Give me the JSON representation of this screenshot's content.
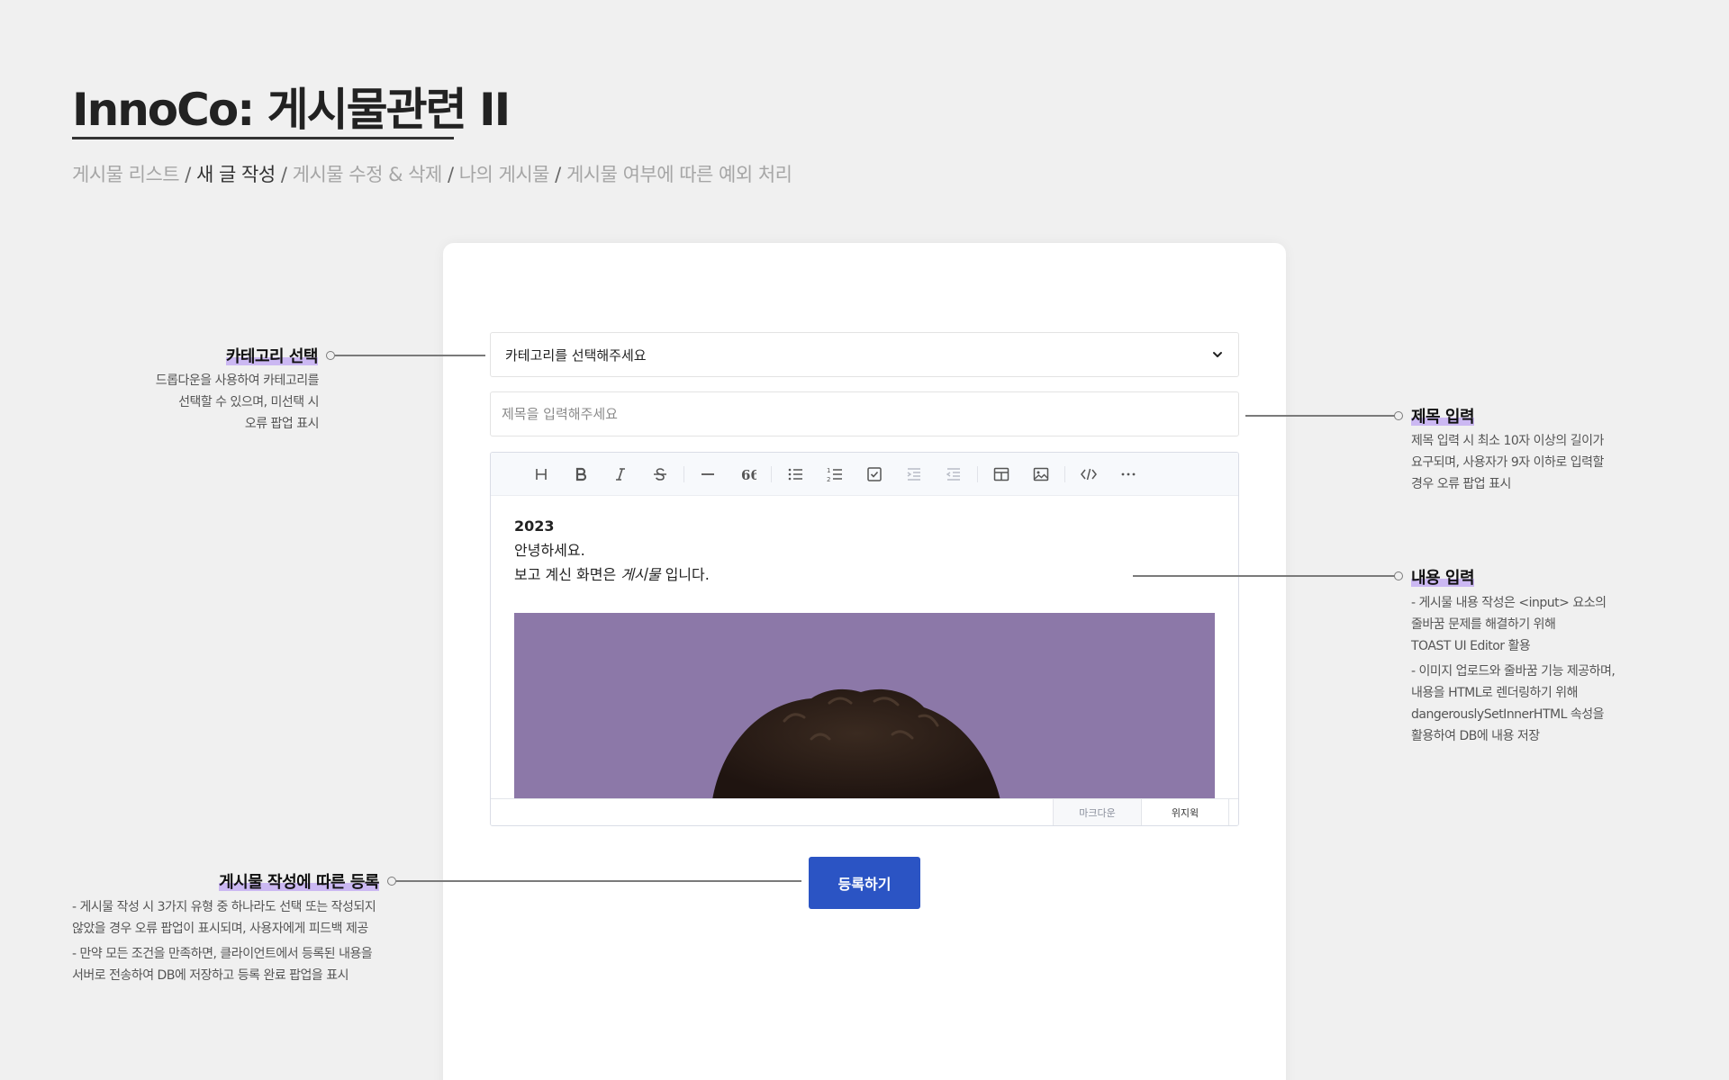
{
  "header": {
    "title": "InnoCo: 게시물관련 II",
    "breadcrumb": {
      "item1": "게시물 리스트",
      "active": "새 글 작성",
      "item3": "게시물 수정 & 삭제",
      "item4": "나의 게시물",
      "item5": "게시물 여부에 따른 예외 처리",
      "separator": " / "
    }
  },
  "form": {
    "category_placeholder": "카테고리를 선택해주세요",
    "title_placeholder": "제목을 입력해주세요",
    "editor": {
      "toolbar": [
        "heading-icon",
        "bold-icon",
        "italic-icon",
        "strike-icon",
        "hr-icon",
        "quote-icon",
        "bullet-list-icon",
        "ordered-list-icon",
        "task-list-icon",
        "indent-icon",
        "outdent-icon",
        "table-icon",
        "image-icon",
        "code-icon",
        "more-icon"
      ],
      "content": {
        "line1": "2023",
        "line2": "안녕하세요.",
        "line3_prefix": "보고 계신 화면은 ",
        "line3_italic": "게시물",
        "line3_suffix": " 입니다."
      },
      "mode_markdown": "마크다운",
      "mode_wysiwyg": "위지윅"
    },
    "submit_label": "등록하기",
    "accent_color": "#2b54c4",
    "image_bg_color": "#8c78a8"
  },
  "annotations": {
    "category": {
      "title": "카테고리 선택",
      "lines": [
        "드롭다운을 사용하여 카테고리를",
        "선택할 수 있으며, 미선택 시",
        "오류 팝업 표시"
      ]
    },
    "title": {
      "title": "제목 입력",
      "lines": [
        "제목 입력 시 최소 10자 이상의 길이가",
        "요구되며, 사용자가 9자 이하로 입력할",
        "경우 오류 팝업 표시"
      ]
    },
    "content": {
      "title": "내용 입력",
      "item1": [
        "- 게시물 내용 작성은 <input> 요소의",
        "줄바꿈 문제를 해결하기 위해",
        "TOAST UI Editor 활용"
      ],
      "item2": [
        "- 이미지 업로드와 줄바꿈 기능 제공하며,",
        "내용을 HTML로 렌더링하기 위해",
        "dangerouslySetInnerHTML 속성을",
        "활용하여 DB에 내용 저장"
      ]
    },
    "submit": {
      "title": "게시물 작성에 따른 등록",
      "item1": [
        "- 게시물 작성 시 3가지 유형 중 하나라도 선택 또는 작성되지",
        "않았을 경우 오류 팝업이 표시되며, 사용자에게 피드백 제공"
      ],
      "item2": [
        "- 만약 모든 조건을 만족하면, 클라이언트에서 등록된 내용을",
        "서버로 전송하여 DB에 저장하고 등록 완료 팝업을 표시"
      ]
    },
    "highlight_color": "#cbb8f2"
  }
}
